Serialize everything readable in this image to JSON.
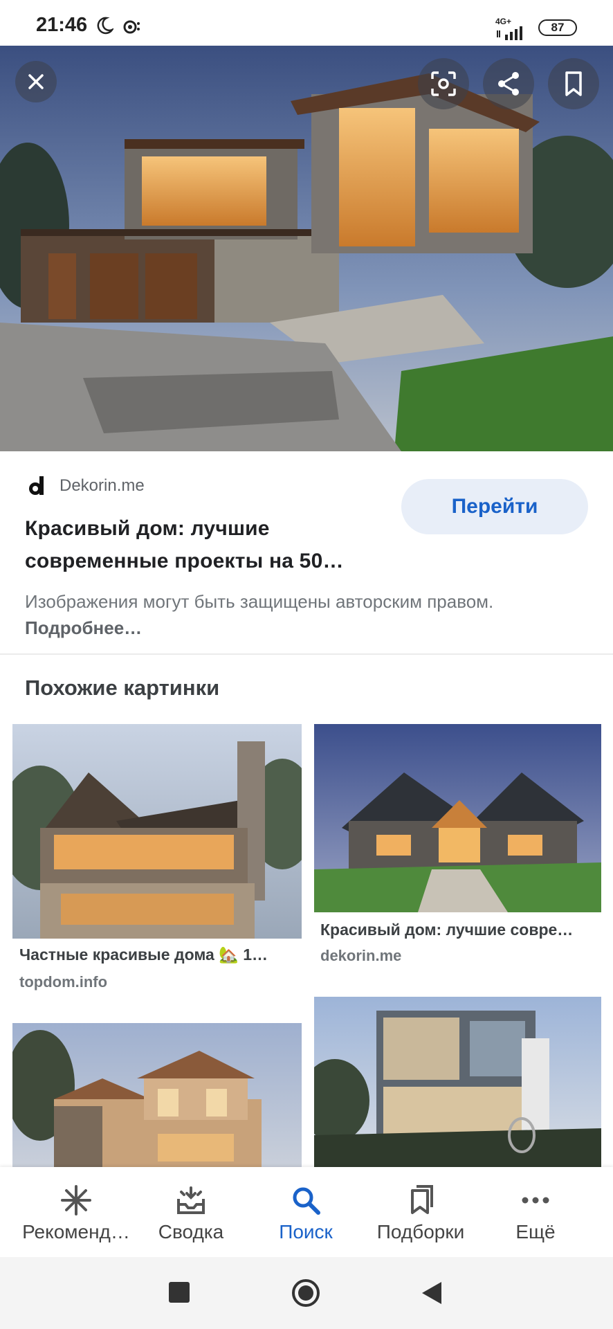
{
  "status_bar": {
    "time": "21:46",
    "network": "4G+",
    "battery": "87"
  },
  "hero": {
    "close_icon": "close-icon",
    "lens_icon": "lens-icon",
    "share_icon": "share-icon",
    "bookmark_icon": "bookmark-icon"
  },
  "result": {
    "source": "Dekorin.me",
    "title_line1": "Красивый дом: лучшие",
    "title_line2": "современные проекты на 50…",
    "go_label": "Перейти",
    "copyright_text": "Изображения могут быть защищены авторским правом.",
    "more_label": "Подробнее…"
  },
  "similar": {
    "heading": "Похожие картинки",
    "items": [
      {
        "caption": "Частные красивые дома 🏡 1…",
        "domain": "topdom.info"
      },
      {
        "caption": "Красивый дом: лучшие совре…",
        "domain": "dekorin.me"
      },
      {
        "caption": "",
        "domain": ""
      },
      {
        "caption": "",
        "domain": ""
      }
    ]
  },
  "bottom_nav": {
    "items": [
      {
        "label": "Рекоменд…",
        "icon": "asterisk-icon"
      },
      {
        "label": "Сводка",
        "icon": "inbox-icon"
      },
      {
        "label": "Поиск",
        "icon": "search-icon",
        "active": true
      },
      {
        "label": "Подборки",
        "icon": "collections-icon"
      },
      {
        "label": "Ещё",
        "icon": "more-icon"
      }
    ]
  },
  "colors": {
    "accent": "#1a62c9",
    "button_bg": "#e8eef8"
  }
}
